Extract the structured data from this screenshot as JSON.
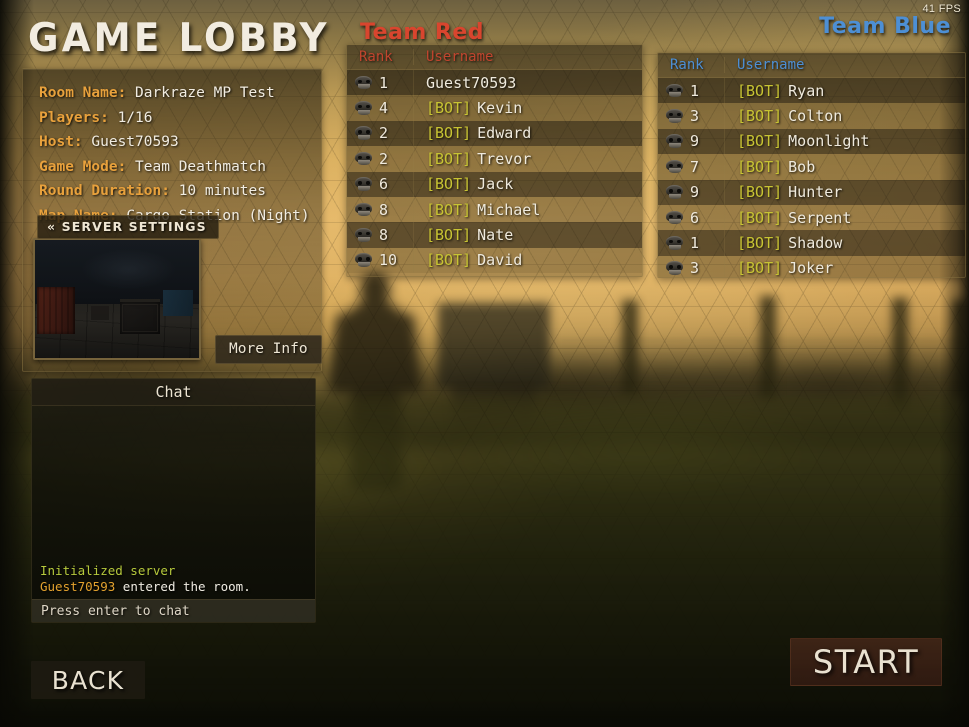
{
  "hud": {
    "fps": "41 FPS"
  },
  "page_title": "GAME LOBBY",
  "info": {
    "rows": [
      {
        "key": "Room Name:",
        "value": "Darkraze MP Test"
      },
      {
        "key": "Players:",
        "value": "1/16"
      },
      {
        "key": "Host:",
        "value": "Guest70593"
      },
      {
        "key": "Game Mode:",
        "value": "Team Deathmatch"
      },
      {
        "key": "Round Duration:",
        "value": "10 minutes"
      },
      {
        "key": "Map Name:",
        "value": "Cargo Station (Night)"
      }
    ]
  },
  "buttons": {
    "server_settings": "« SERVER SETTINGS",
    "more_info": "More Info",
    "back": "BACK",
    "start": "START"
  },
  "map_preview": {
    "alt": "Cargo Station (Night) preview"
  },
  "chat": {
    "header": "Chat",
    "input_placeholder": "Press enter to chat",
    "lines": [
      {
        "system": "Initialized server",
        "user": "",
        "text": ""
      },
      {
        "system": "",
        "user": "Guest70593",
        "text": " entered the room."
      }
    ]
  },
  "teams": [
    {
      "id": "red",
      "title": "Team Red",
      "accent": "#d9452e",
      "columns": {
        "rank": "Rank",
        "username": "Username"
      },
      "players": [
        {
          "rank": "1",
          "bot": "",
          "name": "Guest70593"
        },
        {
          "rank": "4",
          "bot": "[BOT]",
          "name": "Kevin"
        },
        {
          "rank": "2",
          "bot": "[BOT]",
          "name": "Edward"
        },
        {
          "rank": "2",
          "bot": "[BOT]",
          "name": "Trevor"
        },
        {
          "rank": "6",
          "bot": "[BOT]",
          "name": "Jack"
        },
        {
          "rank": "8",
          "bot": "[BOT]",
          "name": "Michael"
        },
        {
          "rank": "8",
          "bot": "[BOT]",
          "name": "Nate"
        },
        {
          "rank": "10",
          "bot": "[BOT]",
          "name": "David"
        }
      ]
    },
    {
      "id": "blue",
      "title": "Team Blue",
      "accent": "#4d8fd4",
      "columns": {
        "rank": "Rank",
        "username": "Username"
      },
      "players": [
        {
          "rank": "1",
          "bot": "[BOT]",
          "name": "Ryan"
        },
        {
          "rank": "3",
          "bot": "[BOT]",
          "name": "Colton"
        },
        {
          "rank": "9",
          "bot": "[BOT]",
          "name": "Moonlight"
        },
        {
          "rank": "7",
          "bot": "[BOT]",
          "name": "Bob"
        },
        {
          "rank": "9",
          "bot": "[BOT]",
          "name": "Hunter"
        },
        {
          "rank": "6",
          "bot": "[BOT]",
          "name": "Serpent"
        },
        {
          "rank": "1",
          "bot": "[BOT]",
          "name": "Shadow"
        },
        {
          "rank": "3",
          "bot": "[BOT]",
          "name": "Joker"
        }
      ]
    }
  ],
  "colors": {
    "accent_orange": "#e8a13c",
    "team_red": "#d9452e",
    "team_blue": "#4d8fd4",
    "bot_tag": "#c8c433",
    "chat_system": "#b6c93c",
    "chat_user": "#e3a22e",
    "text_light": "#f1ece1"
  }
}
